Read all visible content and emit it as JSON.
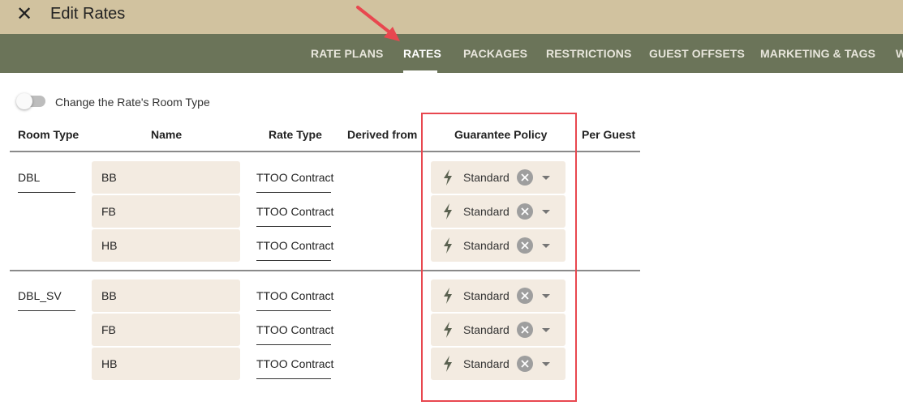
{
  "window": {
    "title": "Edit Rates",
    "close_symbol": "✕"
  },
  "tabs": [
    {
      "label": "RATE PLANS"
    },
    {
      "label": "RATES"
    },
    {
      "label": "PACKAGES"
    },
    {
      "label": "RESTRICTIONS"
    },
    {
      "label": "GUEST OFFSETS"
    },
    {
      "label": "MARKETING & TAGS"
    },
    {
      "label": "W"
    }
  ],
  "active_tab": "RATES",
  "toggle": {
    "label": "Change the Rate's Room Type",
    "on": false
  },
  "table": {
    "headers": [
      "Room Type",
      "Name",
      "Rate Type",
      "Derived from",
      "Guarantee Policy",
      "Per Guest"
    ],
    "groups": [
      {
        "room_type": "DBL",
        "rows": [
          {
            "name": "BB",
            "rate_type": "TTOO Contract",
            "derived_from": "",
            "guarantee_policy": "Standard"
          },
          {
            "name": "FB",
            "rate_type": "TTOO Contract",
            "derived_from": "",
            "guarantee_policy": "Standard"
          },
          {
            "name": "HB",
            "rate_type": "TTOO Contract",
            "derived_from": "",
            "guarantee_policy": "Standard"
          }
        ]
      },
      {
        "room_type": "DBL_SV",
        "rows": [
          {
            "name": "BB",
            "rate_type": "TTOO Contract",
            "derived_from": "",
            "guarantee_policy": "Standard"
          },
          {
            "name": "FB",
            "rate_type": "TTOO Contract",
            "derived_from": "",
            "guarantee_policy": "Standard"
          },
          {
            "name": "HB",
            "rate_type": "TTOO Contract",
            "derived_from": "",
            "guarantee_policy": "Standard"
          }
        ]
      }
    ]
  },
  "icons": {
    "close": "close-icon",
    "policy": "bolt-icon",
    "clear": "clear-circle-icon",
    "dropdown": "caret-down-icon"
  },
  "colors": {
    "top_bar": "#d1c29f",
    "tab_bar": "#6b7459",
    "field_background": "#f3ebe1",
    "highlight_annotation": "#e8474f"
  }
}
